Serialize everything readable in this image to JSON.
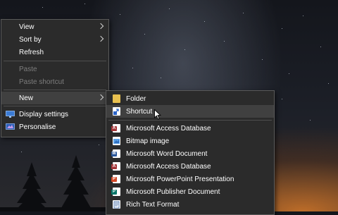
{
  "context_menu": {
    "items": [
      {
        "label": "View",
        "submenu": true,
        "disabled": false
      },
      {
        "label": "Sort by",
        "submenu": true,
        "disabled": false
      },
      {
        "label": "Refresh",
        "submenu": false,
        "disabled": false
      },
      {
        "label": "Paste",
        "submenu": false,
        "disabled": true
      },
      {
        "label": "Paste shortcut",
        "submenu": false,
        "disabled": true
      },
      {
        "label": "New",
        "submenu": true,
        "disabled": false,
        "highlighted": true
      },
      {
        "label": "Display settings",
        "icon": "display-icon"
      },
      {
        "label": "Personalise",
        "icon": "personalise-icon"
      }
    ]
  },
  "new_submenu": {
    "items": [
      {
        "label": "Folder",
        "icon": "folder-icon"
      },
      {
        "label": "Shortcut",
        "icon": "shortcut-icon",
        "highlighted": true
      },
      {
        "label": "Microsoft Access Database",
        "icon": "access-icon"
      },
      {
        "label": "Bitmap image",
        "icon": "bitmap-icon"
      },
      {
        "label": "Microsoft Word Document",
        "icon": "word-icon"
      },
      {
        "label": "Microsoft Access Database",
        "icon": "access-icon"
      },
      {
        "label": "Microsoft PowerPoint Presentation",
        "icon": "powerpoint-icon"
      },
      {
        "label": "Microsoft Publisher Document",
        "icon": "publisher-icon"
      },
      {
        "label": "Rich Text Format",
        "icon": "rtf-icon"
      }
    ]
  },
  "colors": {
    "menu_bg": "#2b2b2b",
    "highlight": "#404040",
    "access": "#a4373a",
    "word": "#2b579a",
    "powerpoint": "#d24726",
    "publisher": "#077568",
    "folder": "#e8c04f"
  }
}
